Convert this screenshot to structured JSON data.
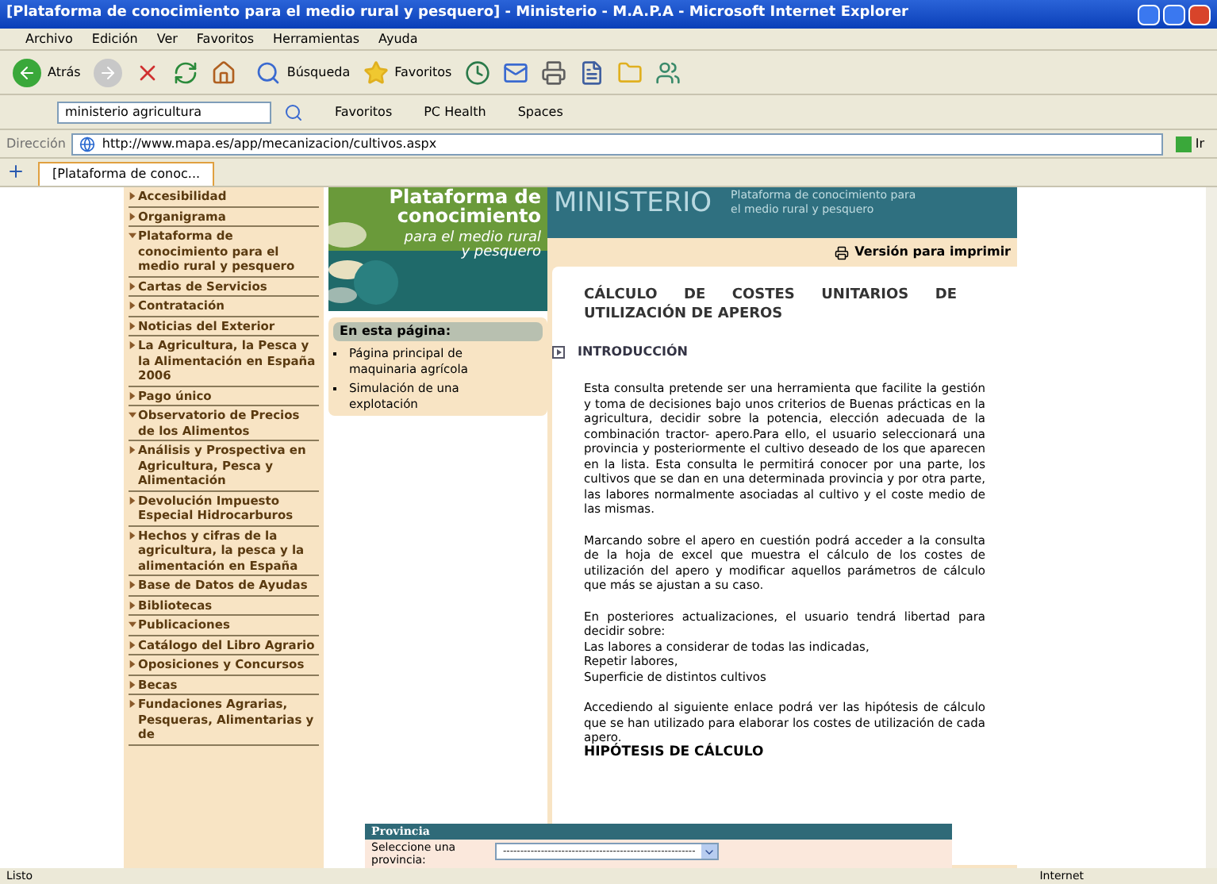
{
  "window": {
    "title": "[Plataforma de conocimiento para el medio rural y pesquero] - Ministerio - M.A.P.A - Microsoft Internet Explorer"
  },
  "menu": [
    "Archivo",
    "Edición",
    "Ver",
    "Favoritos",
    "Herramientas",
    "Ayuda"
  ],
  "toolbar": {
    "back": "Atrás",
    "search": "Búsqueda",
    "favorites": "Favoritos"
  },
  "links_bar": {
    "search_value": "ministerio agricultura",
    "items": [
      "Favoritos",
      "PC Health",
      "Spaces"
    ]
  },
  "address": {
    "label": "Dirección",
    "url": "http://www.mapa.es/app/mecanizacion/cultivos.aspx",
    "go": "Ir"
  },
  "tabs": [
    {
      "label": "[Plataforma de conoc...",
      "selected": true
    }
  ],
  "nav": [
    {
      "label": "Accesibilidad",
      "expanded": false
    },
    {
      "label": "Organigrama",
      "expanded": false
    },
    {
      "label": "Plataforma de conocimiento para el medio rural y pesquero",
      "expanded": true
    },
    {
      "label": "Cartas de Servicios",
      "expanded": false
    },
    {
      "label": "Contratación",
      "expanded": false
    },
    {
      "label": "Noticias del Exterior",
      "expanded": false
    },
    {
      "label": "La Agricultura, la Pesca y la Alimentación en España 2006",
      "expanded": false
    },
    {
      "label": "Pago único",
      "expanded": false
    },
    {
      "label": "Observatorio de Precios de los Alimentos",
      "expanded": true
    },
    {
      "label": "Análisis y Prospectiva en Agricultura, Pesca y Alimentación",
      "expanded": false
    },
    {
      "label": "Devolución Impuesto Especial Hidrocarburos",
      "expanded": false
    },
    {
      "label": "Hechos y cifras de la agricultura, la pesca y la alimentación en España",
      "expanded": false
    },
    {
      "label": "Base de Datos de Ayudas",
      "expanded": false
    },
    {
      "label": "Bibliotecas",
      "expanded": false
    },
    {
      "label": "Publicaciones",
      "expanded": true
    },
    {
      "label": "Catálogo del Libro Agrario",
      "expanded": false
    },
    {
      "label": "Oposiciones y Concursos",
      "expanded": false
    },
    {
      "label": "Becas",
      "expanded": false
    },
    {
      "label": "Fundaciones Agrarias, Pesqueras, Alimentarias y de",
      "expanded": false
    }
  ],
  "banner": {
    "lines": [
      "Plataforma de",
      "conocimiento",
      "para el medio rural",
      "y pesquero"
    ]
  },
  "header": {
    "title": "MINISTERIO",
    "subtitle": "Plataforma de conocimiento para el medio rural y pesquero"
  },
  "print_link": "Versión para imprimir",
  "on_this_page": {
    "title": "En esta página:",
    "links": [
      "Página principal de maquinaria agrícola",
      "Simulación de una explotación"
    ]
  },
  "article": {
    "title": "CÁLCULO DE COSTES UNITARIOS DE UTILIZACIÓN DE APEROS",
    "section": "INTRODUCCIÓN",
    "paragraphs": [
      [
        "Esta consulta pretende ser una herramienta que facilite la gestión y toma de decisiones bajo unos criterios de Buenas prácticas en la agricultura, decidir sobre la potencia, elección adecuada de la combinación tractor- apero.Para ello, el usuario seleccionará una provincia y posteriormente el cultivo deseado de los que aparecen en la lista. Esta consulta le permitirá conocer por una parte, los cultivos que se dan en una determinada provincia y por otra parte, las labores normalmente asociadas al cultivo y el coste medio de las mismas."
      ],
      [
        "Marcando sobre el apero en cuestión podrá acceder a la consulta de la hoja de excel que muestra el cálculo de los costes de utilización del apero y modificar aquellos parámetros de cálculo que más se ajustan a su caso."
      ],
      [
        "En posteriores actualizaciones, el usuario tendrá libertad para decidir sobre:",
        "Las labores a considerar de todas las indicadas,",
        "Repetir labores,",
        "Superficie de distintos cultivos"
      ],
      [
        "Accediendo al siguiente enlace podrá ver las hipótesis de cálculo que se han utilizado para elaborar los costes de utilización de cada apero."
      ]
    ],
    "link": "HIPÓTESIS DE CÁLCULO"
  },
  "province": {
    "title": "Provincia",
    "label": "Seleccione una provincia:",
    "value": "--------------------------------------------------------"
  },
  "status": {
    "text": "Listo",
    "zone": "Internet"
  }
}
